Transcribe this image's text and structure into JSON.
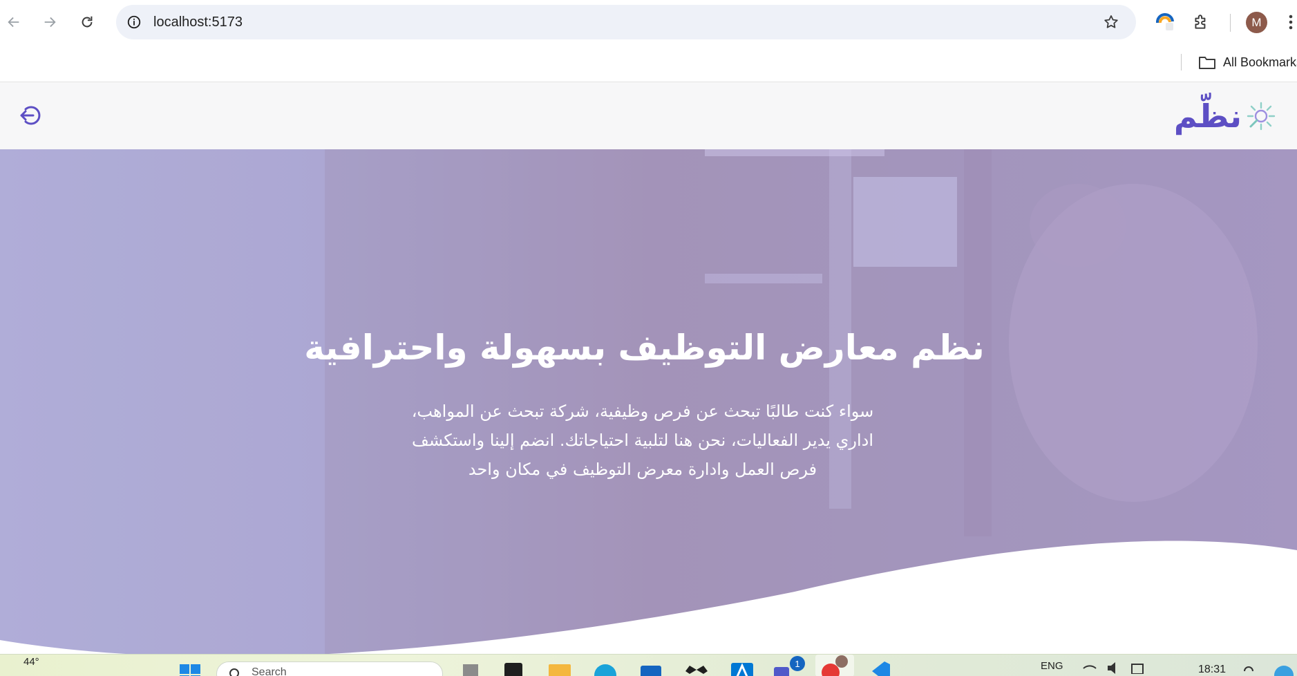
{
  "browser": {
    "url": "localhost:5173",
    "bookmarks_label": "All Bookmarks",
    "profile_initial": "M"
  },
  "app": {
    "logo_text": "نظّم",
    "brand_color": "#5d4fc4",
    "logo_icon": "sun-magnifier-logo-icon",
    "logout_icon": "logout-icon"
  },
  "hero": {
    "title": "نظم معارض التوظيف بسهولة واحترافية",
    "description": "سواء كنت طالبًا تبحث عن فرص وظيفية، شركة تبحث عن المواهب، اداري يدير الفعاليات، نحن هنا لتلبية احتياجاتك. انضم إلينا واستكشف فرص العمل وادارة معرض التوظيف في مكان واحد"
  },
  "taskbar": {
    "weather": "44°",
    "search_placeholder": "Search",
    "teams_badge": "1",
    "language": "ENG",
    "time": "18:31"
  }
}
